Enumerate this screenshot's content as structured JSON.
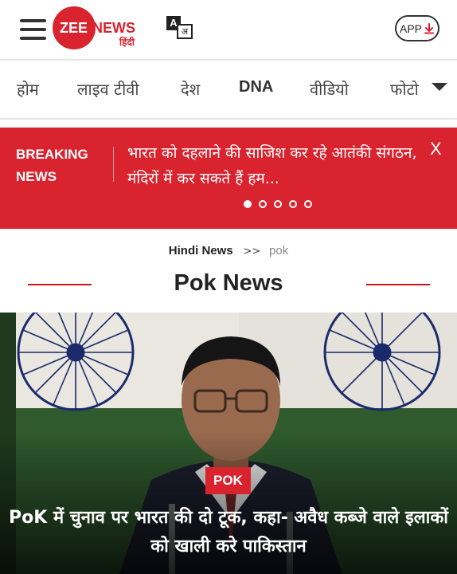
{
  "header": {
    "logo": {
      "zee": "ZEE",
      "news": "NEWS",
      "hindi": "हिंदी"
    },
    "translate_icon": {
      "primary": "A",
      "secondary": "अ"
    },
    "app_button": {
      "label": "APP",
      "icon": "download-icon"
    }
  },
  "nav": {
    "items": [
      {
        "label": "होम"
      },
      {
        "label": "लाइव टीवी"
      },
      {
        "label": "देश"
      },
      {
        "label": "DNA"
      },
      {
        "label": "वीडियो"
      },
      {
        "label": "फोटो"
      }
    ],
    "more_icon": "caret-down-icon"
  },
  "breaking": {
    "label_line1": "BREAKING",
    "label_line2": "NEWS",
    "text": "भारत को दहलाने की साजिश कर रहे आतंकी संगठन, मंदिरों में कर सकते हैं हम...",
    "close": "X",
    "active_dot": 1,
    "dot_count": 5
  },
  "breadcrumb": {
    "home": "Hindi News",
    "separator": ">>",
    "current": "pok"
  },
  "page_title": "Pok News",
  "hero": {
    "tag": "POK",
    "headline": "PoK में चुनाव पर भारत की दो टूक, कहा- अवैध कब्जे वाले इलाकों को खाली करे पाकिस्तान"
  },
  "colors": {
    "brand_red": "#d9232e",
    "text_dark": "#222222",
    "muted": "#888888"
  }
}
